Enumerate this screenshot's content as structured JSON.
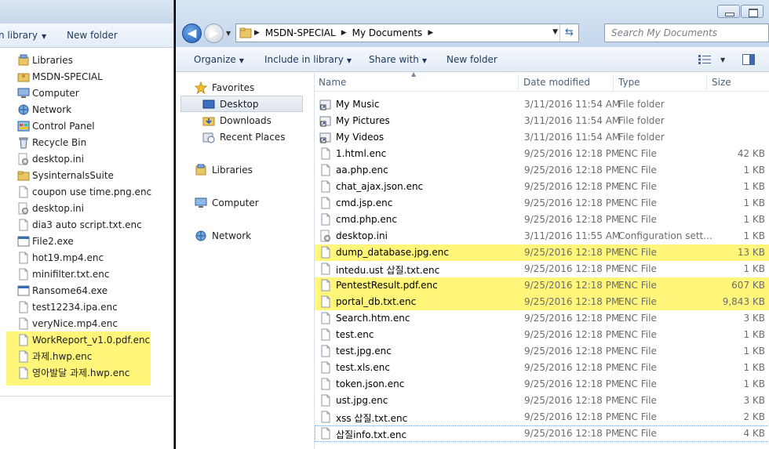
{
  "left_window": {
    "toolbar": {
      "include_label": "n library",
      "new_folder_label": "New folder"
    },
    "items": [
      {
        "label": "Libraries",
        "icon": "libraries-icon"
      },
      {
        "label": "MSDN-SPECIAL",
        "icon": "user-folder-icon"
      },
      {
        "label": "Computer",
        "icon": "computer-icon"
      },
      {
        "label": "Network",
        "icon": "network-icon"
      },
      {
        "label": "Control Panel",
        "icon": "control-panel-icon"
      },
      {
        "label": "Recycle Bin",
        "icon": "recycle-bin-icon"
      },
      {
        "label": "desktop.ini",
        "icon": "settings-file-icon"
      },
      {
        "label": "SysinternalsSuite",
        "icon": "folder-icon"
      },
      {
        "label": "coupon use time.png.enc",
        "icon": "file-icon"
      },
      {
        "label": "desktop.ini",
        "icon": "settings-file-icon"
      },
      {
        "label": "dia3 auto script.txt.enc",
        "icon": "file-icon"
      },
      {
        "label": "File2.exe",
        "icon": "exe-icon"
      },
      {
        "label": "hot19.mp4.enc",
        "icon": "file-icon"
      },
      {
        "label": "minifilter.txt.enc",
        "icon": "file-icon"
      },
      {
        "label": "Ransome64.exe",
        "icon": "exe-icon"
      },
      {
        "label": "test12234.ipa.enc",
        "icon": "file-icon"
      },
      {
        "label": "veryNice.mp4.enc",
        "icon": "file-icon"
      },
      {
        "label": "WorkReport_v1.0.pdf.enc",
        "icon": "file-icon"
      },
      {
        "label": "과제.hwp.enc",
        "icon": "file-icon"
      },
      {
        "label": "영아발달 과제.hwp.enc",
        "icon": "file-icon"
      }
    ]
  },
  "right_window": {
    "address": {
      "crumbs": [
        "MSDN-SPECIAL",
        "My Documents"
      ]
    },
    "search": {
      "placeholder": "Search My Documents"
    },
    "toolbar": {
      "organize": "Organize",
      "include_in_library": "Include in library",
      "share_with": "Share with",
      "new_folder": "New folder"
    },
    "nav": {
      "favorites": "Favorites",
      "desktop": "Desktop",
      "downloads": "Downloads",
      "recent_places": "Recent Places",
      "libraries": "Libraries",
      "computer": "Computer",
      "network": "Network"
    },
    "columns": {
      "name": "Name",
      "date": "Date modified",
      "type": "Type",
      "size": "Size"
    },
    "files": [
      {
        "name": "My Music",
        "date": "3/11/2016 11:54 AM",
        "type": "File folder",
        "size": "",
        "icon": "shortcut-folder-icon"
      },
      {
        "name": "My Pictures",
        "date": "3/11/2016 11:54 AM",
        "type": "File folder",
        "size": "",
        "icon": "shortcut-folder-icon"
      },
      {
        "name": "My Videos",
        "date": "3/11/2016 11:54 AM",
        "type": "File folder",
        "size": "",
        "icon": "shortcut-folder-icon"
      },
      {
        "name": "1.html.enc",
        "date": "9/25/2016 12:18 PM",
        "type": "ENC File",
        "size": "42 KB",
        "icon": "file-icon"
      },
      {
        "name": "aa.php.enc",
        "date": "9/25/2016 12:18 PM",
        "type": "ENC File",
        "size": "1 KB",
        "icon": "file-icon"
      },
      {
        "name": "chat_ajax.json.enc",
        "date": "9/25/2016 12:18 PM",
        "type": "ENC File",
        "size": "1 KB",
        "icon": "file-icon"
      },
      {
        "name": "cmd.jsp.enc",
        "date": "9/25/2016 12:18 PM",
        "type": "ENC File",
        "size": "1 KB",
        "icon": "file-icon"
      },
      {
        "name": "cmd.php.enc",
        "date": "9/25/2016 12:18 PM",
        "type": "ENC File",
        "size": "1 KB",
        "icon": "file-icon"
      },
      {
        "name": "desktop.ini",
        "date": "3/11/2016 11:55 AM",
        "type": "Configuration sett...",
        "size": "1 KB",
        "icon": "settings-file-icon"
      },
      {
        "name": "dump_database.jpg.enc",
        "date": "9/25/2016 12:18 PM",
        "type": "ENC File",
        "size": "13 KB",
        "icon": "file-icon"
      },
      {
        "name": "intedu.ust 삽질.txt.enc",
        "date": "9/25/2016 12:18 PM",
        "type": "ENC File",
        "size": "1 KB",
        "icon": "file-icon"
      },
      {
        "name": "PentestResult.pdf.enc",
        "date": "9/25/2016 12:18 PM",
        "type": "ENC File",
        "size": "607 KB",
        "icon": "file-icon"
      },
      {
        "name": "portal_db.txt.enc",
        "date": "9/25/2016 12:18 PM",
        "type": "ENC File",
        "size": "9,843 KB",
        "icon": "file-icon"
      },
      {
        "name": "Search.htm.enc",
        "date": "9/25/2016 12:18 PM",
        "type": "ENC File",
        "size": "3 KB",
        "icon": "file-icon"
      },
      {
        "name": "test.enc",
        "date": "9/25/2016 12:18 PM",
        "type": "ENC File",
        "size": "1 KB",
        "icon": "file-icon"
      },
      {
        "name": "test.jpg.enc",
        "date": "9/25/2016 12:18 PM",
        "type": "ENC File",
        "size": "1 KB",
        "icon": "file-icon"
      },
      {
        "name": "test.xls.enc",
        "date": "9/25/2016 12:18 PM",
        "type": "ENC File",
        "size": "1 KB",
        "icon": "file-icon"
      },
      {
        "name": "token.json.enc",
        "date": "9/25/2016 12:18 PM",
        "type": "ENC File",
        "size": "1 KB",
        "icon": "file-icon"
      },
      {
        "name": "ust.jpg.enc",
        "date": "9/25/2016 12:18 PM",
        "type": "ENC File",
        "size": "3 KB",
        "icon": "file-icon"
      },
      {
        "name": "xss 삽질.txt.enc",
        "date": "9/25/2016 12:18 PM",
        "type": "ENC File",
        "size": "2 KB",
        "icon": "file-icon"
      },
      {
        "name": "삽질info.txt.enc",
        "date": "9/25/2016 12:18 PM",
        "type": "ENC File",
        "size": "4 KB",
        "icon": "file-icon"
      }
    ]
  },
  "colors": {
    "highlight": "#fff67a",
    "selection": "#dfe6ef",
    "toolbar_text": "#1e395b"
  }
}
